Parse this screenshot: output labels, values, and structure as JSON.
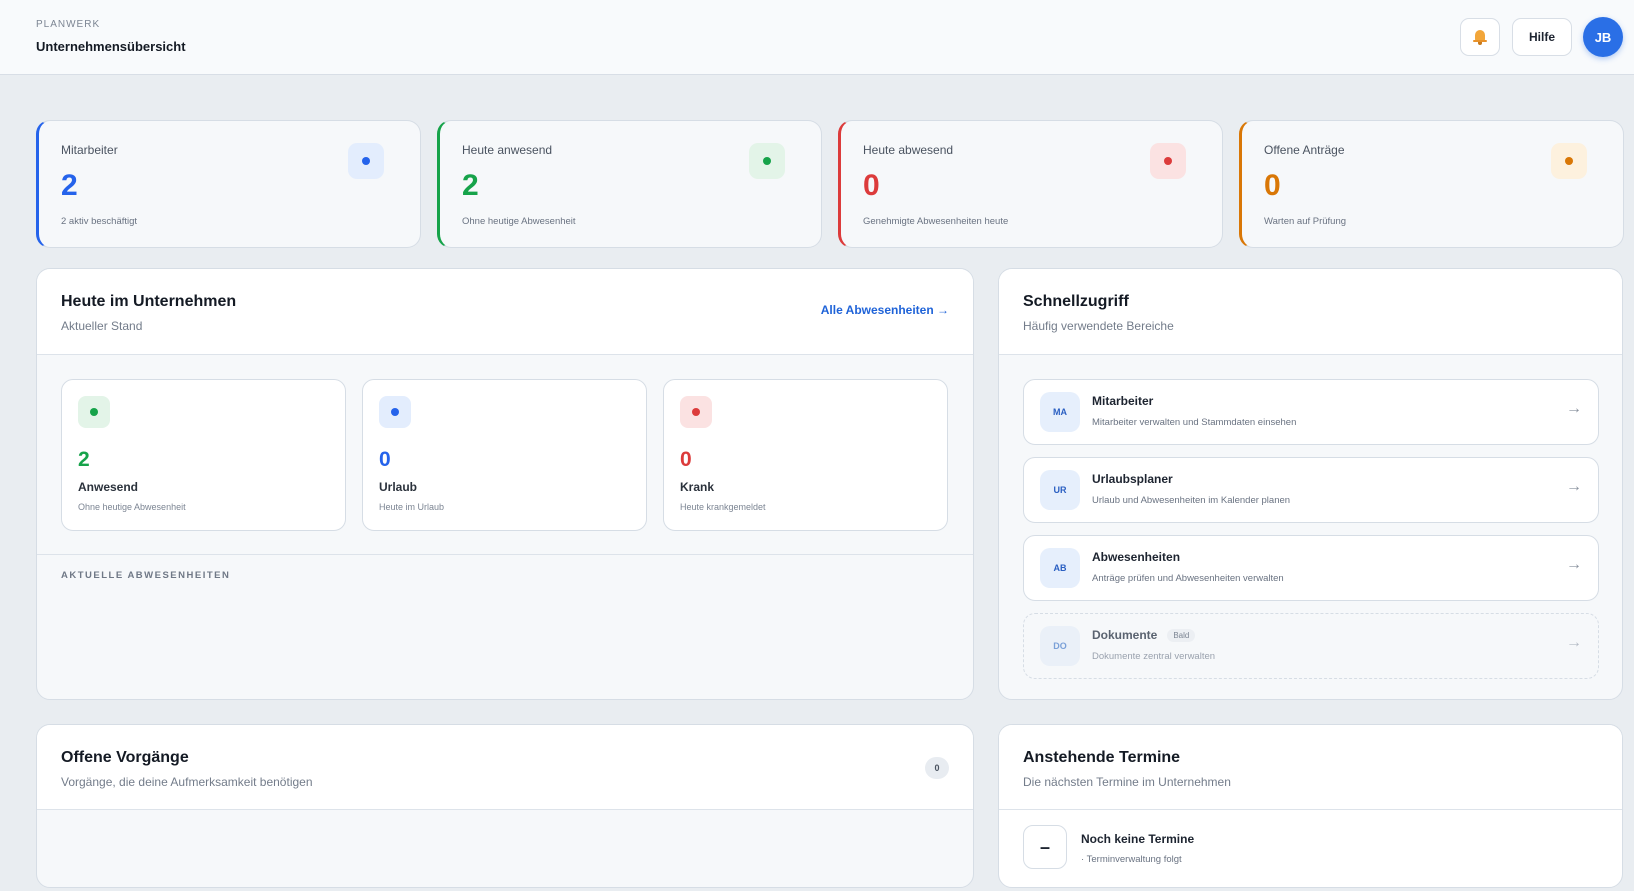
{
  "header": {
    "brand": "PLANWERK",
    "title": "Unternehmensübersicht",
    "help_label": "Hilfe",
    "avatar_initials": "JB",
    "notification_icon": "bell-icon"
  },
  "stats": [
    {
      "label": "Mitarbeiter",
      "value": "2",
      "sub": "2 aktiv beschäftigt",
      "color": "#2563eb",
      "icon_bg": "#e3edfd"
    },
    {
      "label": "Heute anwesend",
      "value": "2",
      "sub": "Ohne heutige Abwesenheit",
      "color": "#16a34a",
      "icon_bg": "#e3f4e8"
    },
    {
      "label": "Heute abwesend",
      "value": "0",
      "sub": "Genehmigte Abwesenheiten heute",
      "color": "#dc3b3b",
      "icon_bg": "#fbe2e2"
    },
    {
      "label": "Offene Anträge",
      "value": "0",
      "sub": "Warten auf Prüfung",
      "color": "#d97706",
      "icon_bg": "#fdf1de"
    }
  ],
  "today": {
    "title": "Heute im Unternehmen",
    "subtitle": "Aktueller Stand",
    "link": "Alle Abwesenheiten →",
    "tiles": [
      {
        "value": "2",
        "label": "Anwesend",
        "desc": "Ohne heutige Abwesenheit",
        "color": "#16a34a",
        "icon_bg": "#e3f4e8"
      },
      {
        "value": "0",
        "label": "Urlaub",
        "desc": "Heute im Urlaub",
        "color": "#2563eb",
        "icon_bg": "#e3edfd"
      },
      {
        "value": "0",
        "label": "Krank",
        "desc": "Heute krankgemeldet",
        "color": "#dc3b3b",
        "icon_bg": "#fbe2e2"
      }
    ],
    "section_caption": "AKTUELLE ABWESENHEITEN"
  },
  "quick": {
    "title": "Schnellzugriff",
    "subtitle": "Häufig verwendete Bereiche",
    "items": [
      {
        "abbr": "MA",
        "title": "Mitarbeiter",
        "desc": "Mitarbeiter verwalten und Stammdaten einsehen",
        "arrow": "→"
      },
      {
        "abbr": "UR",
        "title": "Urlaubsplaner",
        "desc": "Urlaub und Abwesenheiten im Kalender planen",
        "arrow": "→"
      },
      {
        "abbr": "AB",
        "title": "Abwesenheiten",
        "desc": "Anträge prüfen und Abwesenheiten verwalten",
        "arrow": "→"
      },
      {
        "abbr": "DO",
        "title": "Dokumente",
        "badge": "Bald",
        "desc": "Dokumente zentral verwalten",
        "arrow": "→"
      }
    ]
  },
  "open": {
    "title": "Offene Vorgänge",
    "subtitle": "Vorgänge, die deine Aufmerksamkeit benötigen",
    "count": "0"
  },
  "events": {
    "title": "Anstehende Termine",
    "subtitle": "Die nächsten Termine im Unternehmen",
    "empty_icon": "–",
    "empty_title": "Noch keine Termine",
    "empty_desc": "· Terminverwaltung folgt"
  }
}
